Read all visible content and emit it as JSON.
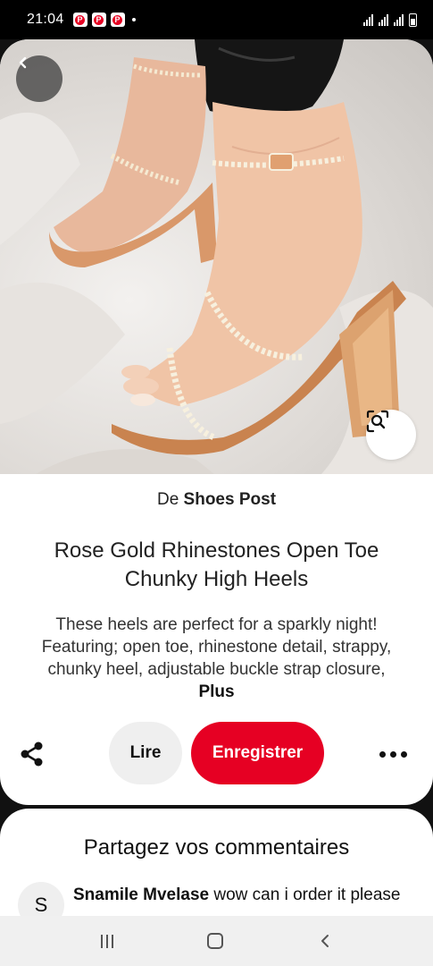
{
  "status_bar": {
    "time": "21:04",
    "notification_app_icons": [
      "pinterest-icon",
      "pinterest-icon",
      "pinterest-icon"
    ]
  },
  "pin": {
    "source_prefix": "De",
    "source_name": "Shoes Post",
    "title": "Rose Gold Rhinestones Open Toe Chunky High Heels",
    "description": "These heels are perfect for a sparkly night! Featuring; open toe, rhinestone detail, strappy, chunky heel, adjustable buckle strap closure,",
    "more_label": "Plus"
  },
  "actions": {
    "read_label": "Lire",
    "save_label": "Enregistrer"
  },
  "comments": {
    "title": "Partagez vos commentaires",
    "items": [
      {
        "avatar_letter": "S",
        "author": "Snamile Mvelase",
        "text": "wow can i order it please"
      }
    ]
  },
  "colors": {
    "accent": "#e60023",
    "secondary_button": "#efefef"
  }
}
